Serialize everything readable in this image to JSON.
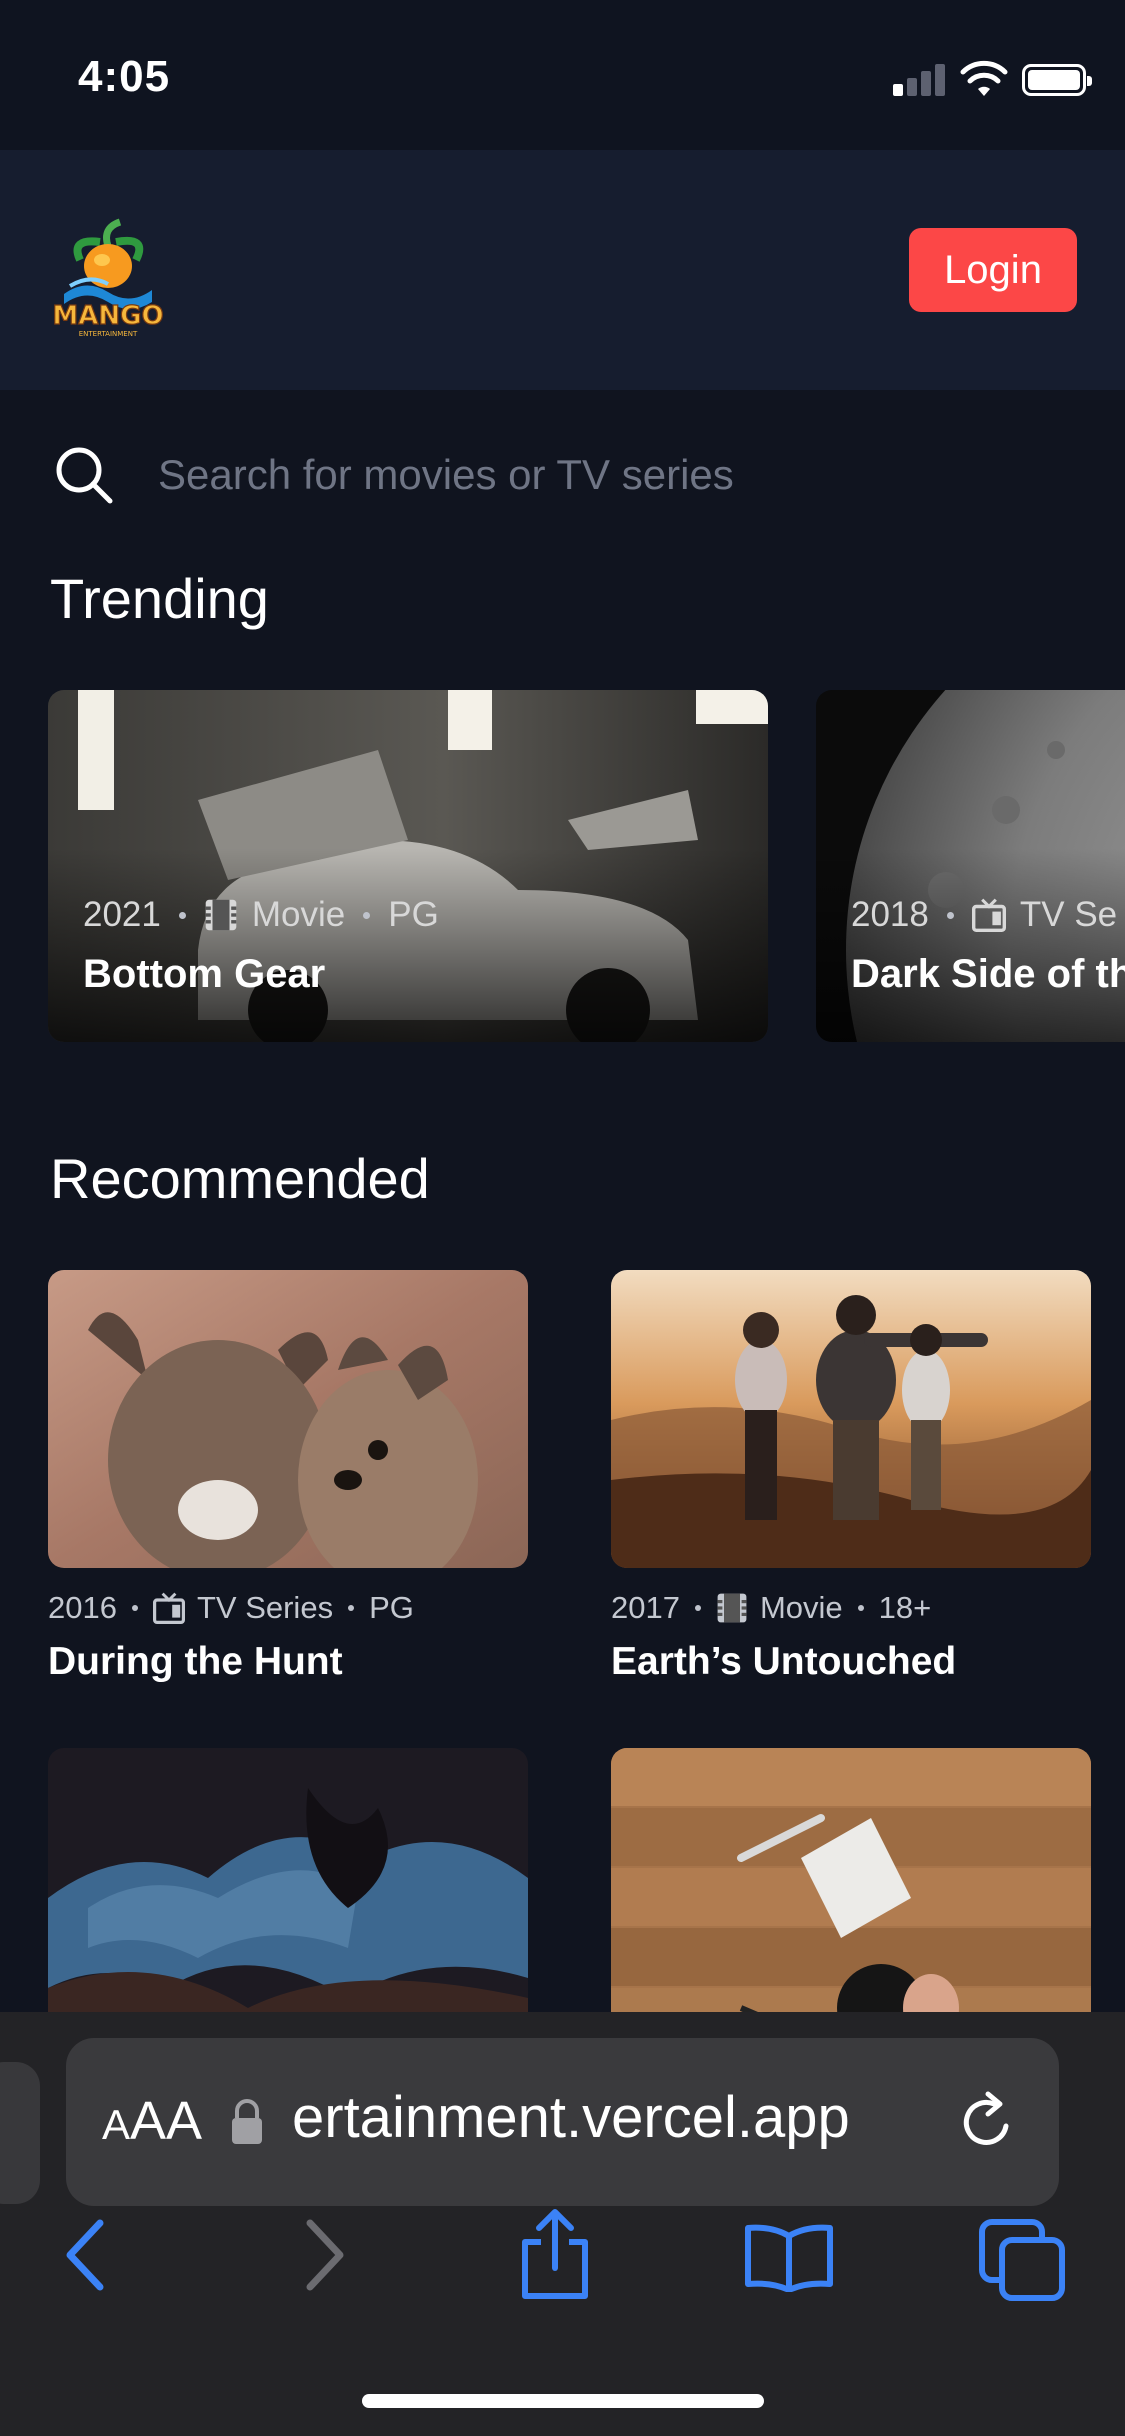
{
  "status_bar": {
    "time": "4:05"
  },
  "header": {
    "logo_text": "MANGO",
    "logo_subtext": "ENTERTAINMENT",
    "login_label": "Login"
  },
  "search": {
    "placeholder": "Search for movies or TV series"
  },
  "trending": {
    "title": "Trending",
    "items": [
      {
        "year": "2021",
        "category": "Movie",
        "rating": "PG",
        "title": "Bottom Gear"
      },
      {
        "year": "2018",
        "category": "TV Se",
        "title": "Dark Side of th"
      }
    ]
  },
  "recommended": {
    "title": "Recommended",
    "items": [
      {
        "year": "2016",
        "category": "TV Series",
        "rating": "PG",
        "title": "During the Hunt"
      },
      {
        "year": "2017",
        "category": "Movie",
        "rating": "18+",
        "title": "Earth’s Untouched"
      },
      {
        "title": ""
      },
      {
        "title": ""
      }
    ]
  },
  "browser": {
    "aa_label": "AA",
    "url": "ertainment.vercel.app"
  },
  "colors": {
    "background": "#10141f",
    "header": "#161d2f",
    "accent": "#fc4747",
    "safari_blue": "#3b82f6"
  }
}
